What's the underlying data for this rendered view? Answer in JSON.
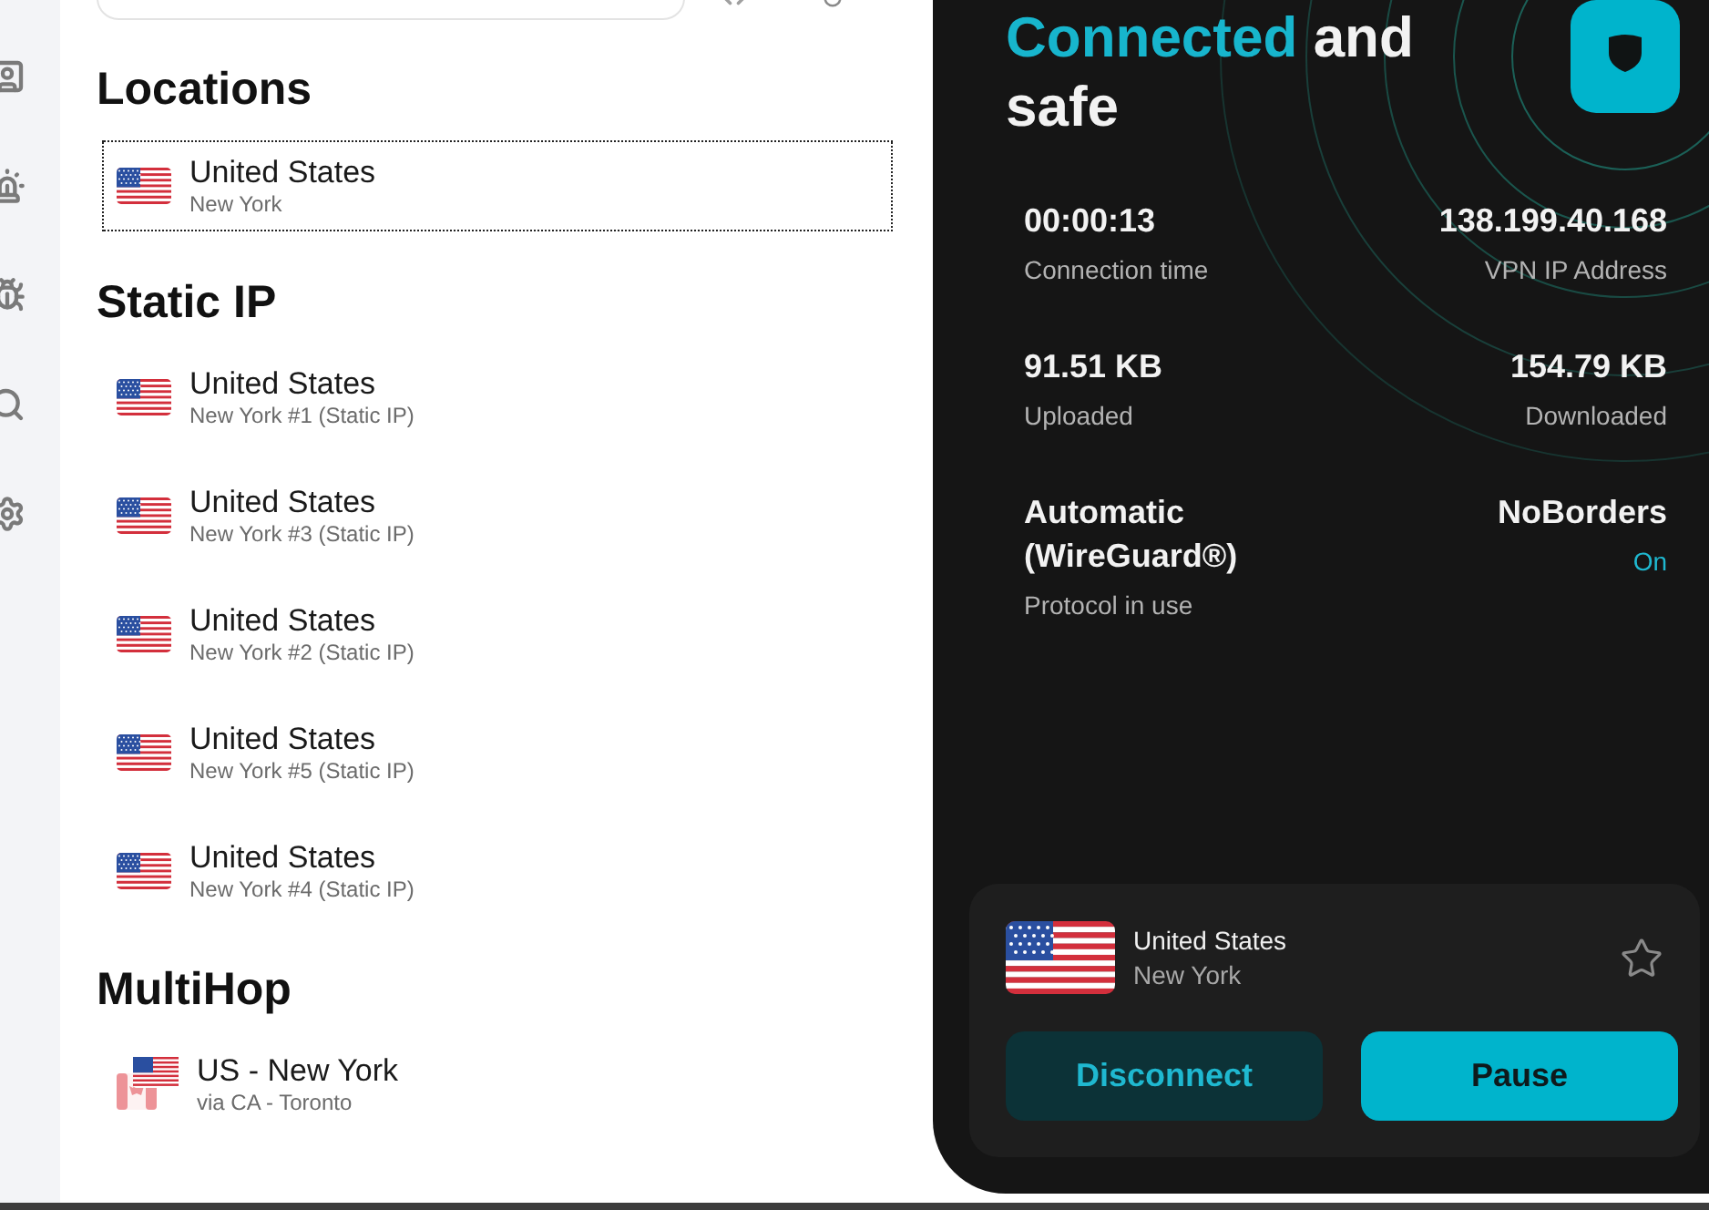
{
  "sections": [
    {
      "heading": "Locations",
      "items": [
        {
          "kind": "single",
          "name": "United States",
          "detail": "New York",
          "selected": true
        }
      ]
    },
    {
      "heading": "Static IP",
      "items": [
        {
          "kind": "single",
          "name": "United States",
          "detail": "New York #1 (Static IP)",
          "selected": false
        },
        {
          "kind": "single",
          "name": "United States",
          "detail": "New York #3 (Static IP)",
          "selected": false
        },
        {
          "kind": "single",
          "name": "United States",
          "detail": "New York #2 (Static IP)",
          "selected": false
        },
        {
          "kind": "single",
          "name": "United States",
          "detail": "New York #5 (Static IP)",
          "selected": false
        },
        {
          "kind": "single",
          "name": "United States",
          "detail": "New York #4 (Static IP)",
          "selected": false
        }
      ]
    },
    {
      "heading": "MultiHop",
      "items": [
        {
          "kind": "multihop",
          "name": "US - New York",
          "detail": "via CA - Toronto",
          "selected": false
        }
      ]
    }
  ],
  "status": {
    "highlight": "Connected",
    "rest": "and safe"
  },
  "stats": [
    {
      "kind": "stat",
      "value": "00:00:13",
      "label": "Connection time"
    },
    {
      "kind": "stat",
      "value": "138.199.40.168",
      "label": "VPN IP Address"
    },
    {
      "kind": "stat",
      "value": "91.51 KB",
      "label": "Uploaded"
    },
    {
      "kind": "stat",
      "value": "154.79 KB",
      "label": "Downloaded"
    },
    {
      "kind": "stat",
      "value": "Automatic (WireGuard®)",
      "label": "Protocol in use"
    },
    {
      "kind": "feature",
      "value": "NoBorders",
      "status": "On"
    }
  ],
  "current_location": {
    "name": "United States",
    "detail": "New York",
    "favorite": false
  },
  "buttons": [
    {
      "kind": "secondary",
      "label": "Disconnect"
    },
    {
      "kind": "primary",
      "label": "Pause"
    }
  ]
}
